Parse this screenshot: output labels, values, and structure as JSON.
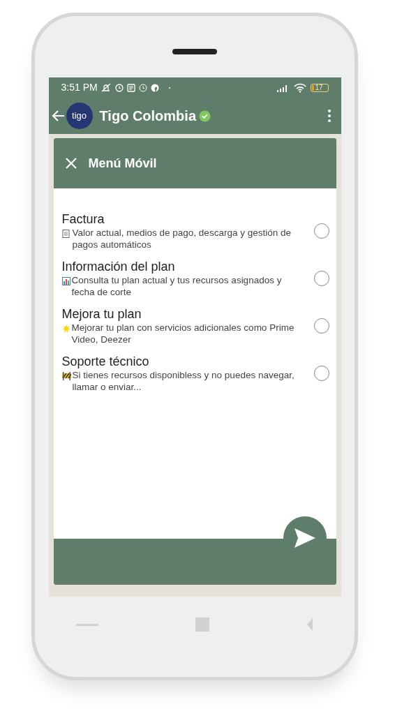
{
  "status_bar": {
    "time": "3:51 PM",
    "battery": "17"
  },
  "chat_header": {
    "avatar_text": "tigo",
    "title": "Tigo Colombia",
    "verified": true
  },
  "menu": {
    "title": "Menú Móvil",
    "options": [
      {
        "kind": "document",
        "title": "Factura",
        "description": "Valor actual, medios de pago, descarga y gestión de pagos automáticos",
        "selected": false
      },
      {
        "kind": "chart",
        "title": "Información del plan",
        "description": "Consulta tu plan actual y tus recursos asignados y fecha de corte",
        "selected": false
      },
      {
        "kind": "star",
        "title": "Mejora tu plan",
        "description": "Mejorar tu plan con servicios adicionales como Prime Video, Deezer",
        "selected": false
      },
      {
        "kind": "barrier",
        "title": "Soporte técnico",
        "description": "Si tienes recursos disponibless y no puedes navegar, llamar o enviar...",
        "selected": false
      }
    ]
  }
}
